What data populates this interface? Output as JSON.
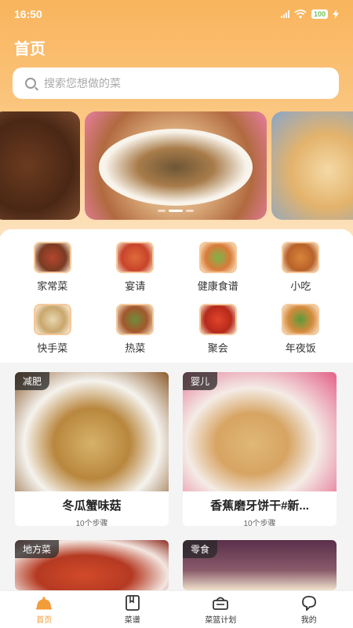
{
  "status": {
    "time": "16:50",
    "battery": "100"
  },
  "header": {
    "title": "首页"
  },
  "search": {
    "placeholder": "搜索您想做的菜"
  },
  "categories": [
    {
      "label": "家常菜"
    },
    {
      "label": "宴请"
    },
    {
      "label": "健康食谱"
    },
    {
      "label": "小吃"
    },
    {
      "label": "快手菜"
    },
    {
      "label": "热菜"
    },
    {
      "label": "聚会"
    },
    {
      "label": "年夜饭"
    }
  ],
  "recipes": [
    {
      "tag": "减肥",
      "title": "冬瓜蟹味菇",
      "steps": "10个步骤"
    },
    {
      "tag": "婴儿",
      "title": "香蕉磨牙饼干#新...",
      "steps": "10个步骤"
    },
    {
      "tag": "地方菜",
      "title": "",
      "steps": ""
    },
    {
      "tag": "零食",
      "title": "",
      "steps": ""
    }
  ],
  "tabs": [
    {
      "label": "首页",
      "icon": "home-icon",
      "active": true
    },
    {
      "label": "菜谱",
      "icon": "book-icon"
    },
    {
      "label": "菜篮计划",
      "icon": "basket-icon"
    },
    {
      "label": "我的",
      "icon": "profile-icon"
    }
  ],
  "colors": {
    "accent": "#f39c3a",
    "header_top": "#f9b45c"
  }
}
